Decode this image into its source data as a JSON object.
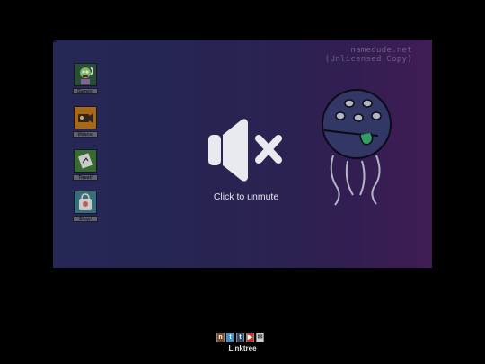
{
  "watermark": {
    "line1": "namedude.net",
    "line2": "(Unlicensed Copy)"
  },
  "desktop_icons": [
    {
      "label": "Games!",
      "icon": "monster-game-icon",
      "color": "#3b6b4a"
    },
    {
      "label": "Videos!",
      "icon": "video-camera-icon",
      "color": "#c0771c"
    },
    {
      "label": "Tweet!",
      "icon": "tweet-icon",
      "color": "#3f7a3a"
    },
    {
      "label": "Shop!",
      "icon": "shopping-bag-icon",
      "color": "#3d7f8a"
    }
  ],
  "mute_overlay": {
    "label": "Click to unmute",
    "icon": "speaker-muted-icon"
  },
  "social_links": [
    {
      "name": "newgrounds",
      "glyph": "n",
      "color": "#7b4a2a"
    },
    {
      "name": "twitter",
      "glyph": "t",
      "color": "#3a8fd6"
    },
    {
      "name": "tumblr",
      "glyph": "t",
      "color": "#2f4b6b"
    },
    {
      "name": "youtube",
      "glyph": "▶",
      "color": "#c4302b"
    },
    {
      "name": "email",
      "glyph": "✉",
      "color": "#cfcfcf"
    }
  ],
  "linktree_label": "Linktree",
  "colors": {
    "background": "#000000",
    "stage_start": "#2b2e63",
    "stage_end": "#4a2160",
    "jelly_body": "#3a3f74",
    "tongue": "#3cb371"
  }
}
